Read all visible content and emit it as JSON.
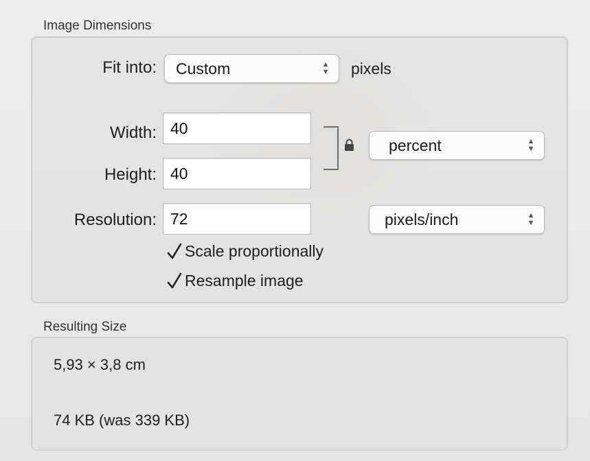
{
  "image_dimensions": {
    "section_title": "Image Dimensions",
    "fit_into": {
      "label": "Fit into:",
      "value": "Custom",
      "unit": "pixels"
    },
    "width": {
      "label": "Width:",
      "value": "40"
    },
    "height": {
      "label": "Height:",
      "value": "40"
    },
    "size_unit": {
      "value": "percent"
    },
    "resolution": {
      "label": "Resolution:",
      "value": "72",
      "unit": "pixels/inch"
    },
    "scale_proportionally": {
      "label": "Scale proportionally",
      "checked": true
    },
    "resample_image": {
      "label": "Resample image",
      "checked": true
    }
  },
  "resulting_size": {
    "section_title": "Resulting Size",
    "dimensions": "5,93 × 3,8 cm",
    "file_size": "74 KB (was 339 KB)"
  },
  "icons": {
    "lock": "lock-icon",
    "checkmark": "checkmark-icon",
    "popup_arrows": "up-down-arrows-icon"
  }
}
